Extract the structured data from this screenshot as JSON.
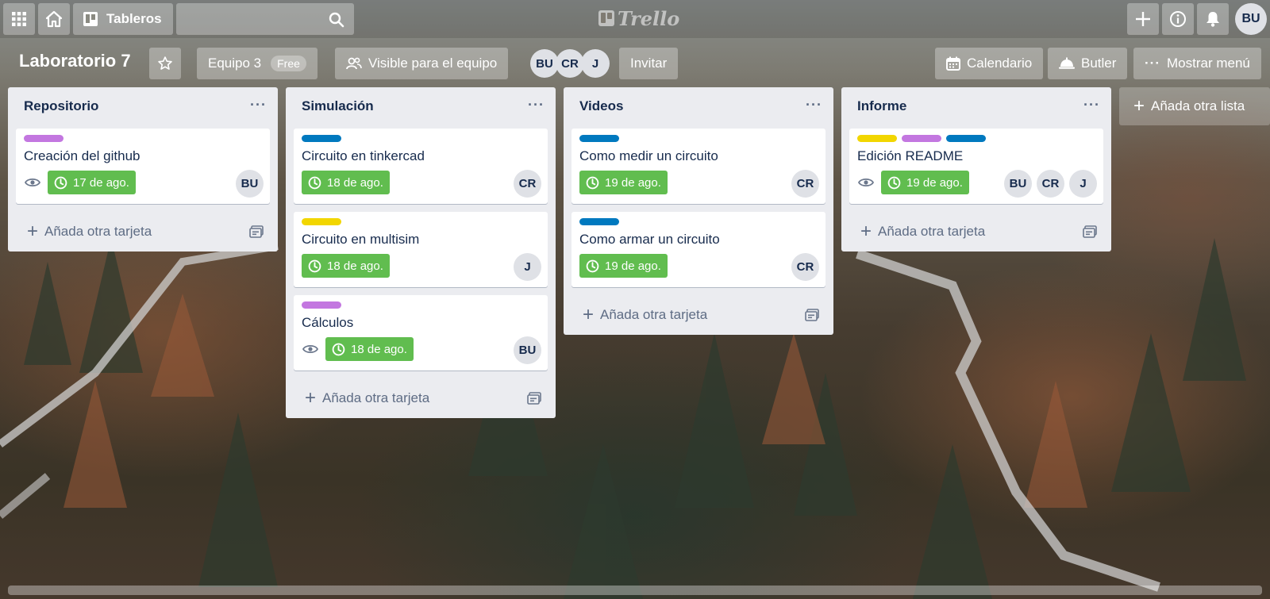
{
  "topbar": {
    "boards_label": "Tableros",
    "search_placeholder": "",
    "logo_text": "Trello",
    "user_initials": "BU"
  },
  "board": {
    "title": "Laboratorio 7",
    "team_label": "Equipo 3",
    "team_plan": "Free",
    "visibility_label": "Visible para el equipo",
    "members": [
      "BU",
      "CR",
      "J"
    ],
    "invite_label": "Invitar",
    "calendar_label": "Calendario",
    "butler_label": "Butler",
    "menu_label": "Mostrar menú"
  },
  "colors": {
    "green": "#61bd4f",
    "purple": "#c377e0",
    "blue": "#0079bf",
    "yellow": "#f2d600"
  },
  "lists": [
    {
      "title": "Repositorio",
      "add_card_label": "Añada otra tarjeta",
      "cards": [
        {
          "labels": [
            "#c377e0"
          ],
          "title": "Creación del github",
          "watch": true,
          "due": "17 de ago.",
          "members": [
            "BU"
          ]
        }
      ]
    },
    {
      "title": "Simulación",
      "add_card_label": "Añada otra tarjeta",
      "cards": [
        {
          "labels": [
            "#0079bf"
          ],
          "title": "Circuito en tinkercad",
          "watch": false,
          "due": "18 de ago.",
          "members": [
            "CR"
          ]
        },
        {
          "labels": [
            "#f2d600"
          ],
          "title": "Circuito en multisim",
          "watch": false,
          "due": "18 de ago.",
          "members": [
            "J"
          ]
        },
        {
          "labels": [
            "#c377e0"
          ],
          "title": "Cálculos",
          "watch": true,
          "due": "18 de ago.",
          "members": [
            "BU"
          ]
        }
      ]
    },
    {
      "title": "Videos",
      "add_card_label": "Añada otra tarjeta",
      "cards": [
        {
          "labels": [
            "#0079bf"
          ],
          "title": "Como medir un circuito",
          "watch": false,
          "due": "19 de ago.",
          "members": [
            "CR"
          ]
        },
        {
          "labels": [
            "#0079bf"
          ],
          "title": "Como armar un circuito",
          "watch": false,
          "due": "19 de ago.",
          "members": [
            "CR"
          ]
        }
      ]
    },
    {
      "title": "Informe",
      "add_card_label": "Añada otra tarjeta",
      "cards": [
        {
          "labels": [
            "#f2d600",
            "#c377e0",
            "#0079bf"
          ],
          "title": "Edición README",
          "watch": true,
          "due": "19 de ago.",
          "members": [
            "BU",
            "CR",
            "J"
          ]
        }
      ]
    }
  ],
  "add_list_label": "Añada otra lista"
}
